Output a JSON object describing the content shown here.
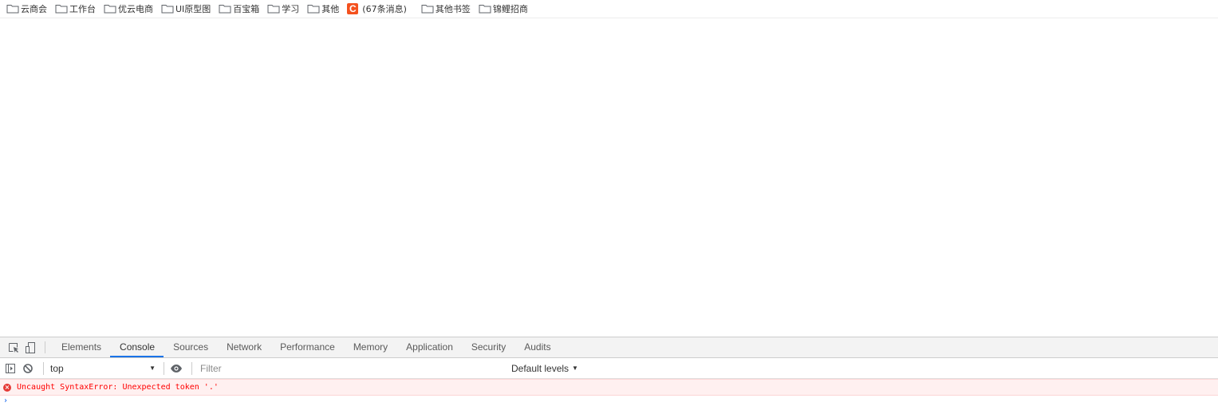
{
  "bookmarks": [
    {
      "label": "云商会",
      "type": "folder"
    },
    {
      "label": "工作台",
      "type": "folder"
    },
    {
      "label": "优云电商",
      "type": "folder"
    },
    {
      "label": "UI原型图",
      "type": "folder"
    },
    {
      "label": "百宝箱",
      "type": "folder"
    },
    {
      "label": "学习",
      "type": "folder"
    },
    {
      "label": "其他",
      "type": "folder"
    },
    {
      "label": "(67条消息)",
      "type": "page",
      "favicon": "C",
      "favicon_color": "#f4511e"
    },
    {
      "label": "其他书签",
      "type": "folder"
    },
    {
      "label": "锦鲤招商",
      "type": "folder"
    }
  ],
  "devtools": {
    "tabs": [
      "Elements",
      "Console",
      "Sources",
      "Network",
      "Performance",
      "Memory",
      "Application",
      "Security",
      "Audits"
    ],
    "active_tab": "Console",
    "toolbar": {
      "context": "top",
      "filter_placeholder": "Filter",
      "levels": "Default levels"
    },
    "messages": [
      {
        "level": "error",
        "text": "Uncaught SyntaxError: Unexpected token '.'"
      }
    ],
    "prompt": "›"
  },
  "colors": {
    "accent": "#1a73e8",
    "error_text": "#ff0000",
    "error_bg": "#fff0f0",
    "favicon": "#f4511e"
  }
}
